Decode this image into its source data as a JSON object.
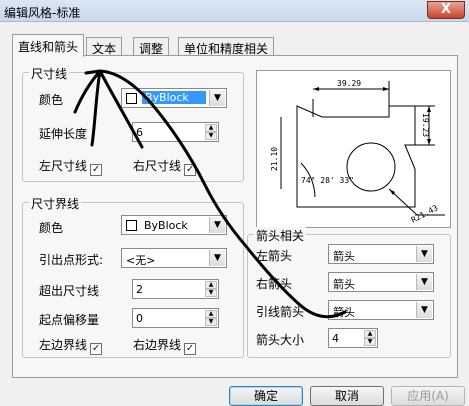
{
  "window": {
    "title": "编辑风格-标准",
    "close_label": "X"
  },
  "tabs": [
    {
      "label": "直线和箭头",
      "active": true
    },
    {
      "label": "文本",
      "active": false
    },
    {
      "label": "调整",
      "active": false
    },
    {
      "label": "单位和精度相关",
      "active": false
    }
  ],
  "dim_line": {
    "title": "尺寸线",
    "color_label": "颜色",
    "color_value": "ByBlock",
    "extend_label": "延伸长度",
    "extend_value": "6",
    "left_check": "左尺寸线",
    "right_check": "右尺寸线"
  },
  "ext_line": {
    "title": "尺寸界线",
    "color_label": "颜色",
    "color_value": "ByBlock",
    "origin_form_label": "引出点形式:",
    "origin_form_value": "<无>",
    "beyond_label": "超出尺寸线",
    "beyond_value": "2",
    "offset_label": "起点偏移量",
    "offset_value": "0",
    "left_check": "左边界线",
    "right_check": "右边界线"
  },
  "arrow": {
    "title": "箭头相关",
    "left_label": "左箭头",
    "left_value": "箭头",
    "right_label": "右箭头",
    "right_value": "箭头",
    "leader_label": "引线箭头",
    "leader_value": "箭头",
    "size_label": "箭头大小",
    "size_value": "4"
  },
  "preview": {
    "dim_top": "39.29",
    "dim_right": "19.23",
    "dim_left": "21.10",
    "angle": "74° 28' 33\"",
    "radius": "R21.43"
  },
  "buttons": {
    "ok": "确定",
    "cancel": "取消",
    "apply": "应用(A)"
  },
  "check_mark": "✓",
  "arrow_glyph": "▼",
  "up_glyph": "▲",
  "colors": {
    "selection": "#3399ff",
    "stroke": "#000000"
  }
}
